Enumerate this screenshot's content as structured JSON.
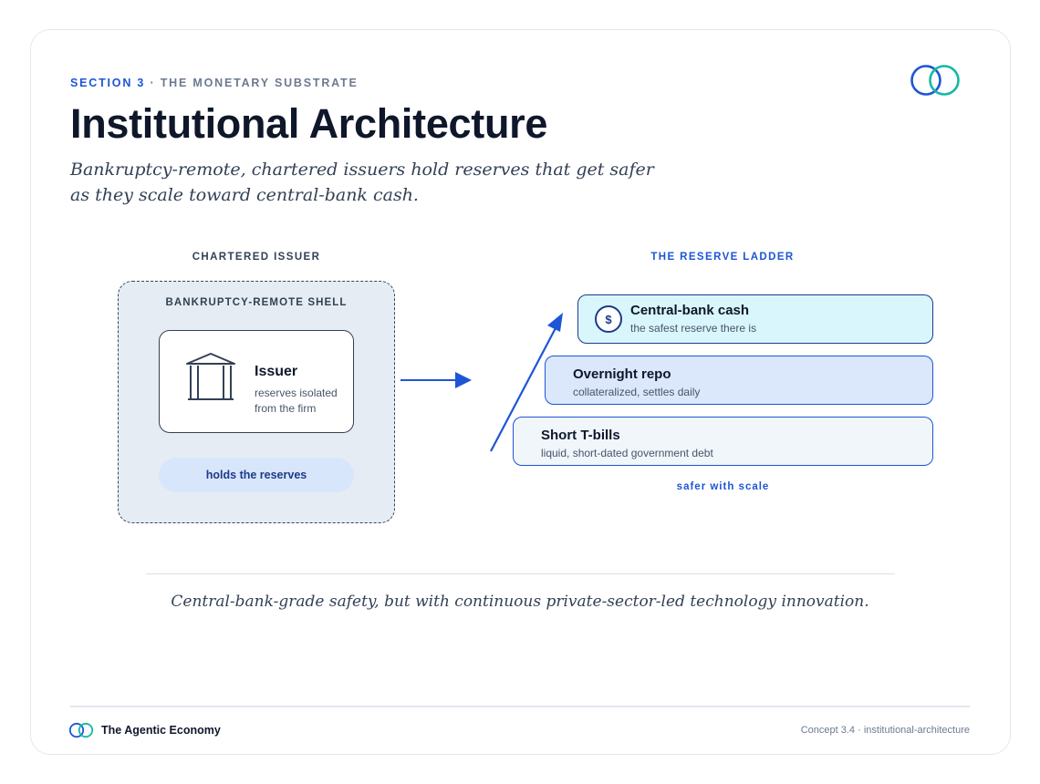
{
  "header": {
    "section_label": "SECTION 3",
    "section_sep": " · ",
    "section_name": "THE MONETARY SUBSTRATE",
    "title": "Institutional Architecture",
    "subtitle": "Bankruptcy-remote, chartered issuers hold reserves that get safer as they scale toward central-bank cash."
  },
  "issuer_panel": {
    "column_label": "CHARTERED ISSUER",
    "shell_label": "BANKRUPTCY-REMOTE SHELL",
    "issuer_title": "Issuer",
    "issuer_subtitle": "reserves isolated from the firm",
    "icon": "bank-building-icon",
    "pill": "holds the reserves"
  },
  "ladder": {
    "column_label": "THE RESERVE LADDER",
    "rungs": [
      {
        "title": "Central-bank cash",
        "subtitle": "the safest reserve there is",
        "icon": "dollar-icon",
        "icon_glyph": "$"
      },
      {
        "title": "Overnight repo",
        "subtitle": "collateralized, settles daily"
      },
      {
        "title": "Short T-bills",
        "subtitle": "liquid, short-dated government debt"
      }
    ],
    "caption": "safer with scale"
  },
  "tagline": "Central-bank-grade safety, but with continuous private-sector-led technology innovation.",
  "footer": {
    "brand": "The Agentic Economy",
    "reference": "Concept 3.4 · institutional-architecture"
  },
  "colors": {
    "accent_blue": "#1d55d6",
    "accent_teal": "#14b8a6",
    "navy": "#1e3a8a",
    "ink": "#0f172a",
    "shell_fill": "#e5ecf3"
  }
}
